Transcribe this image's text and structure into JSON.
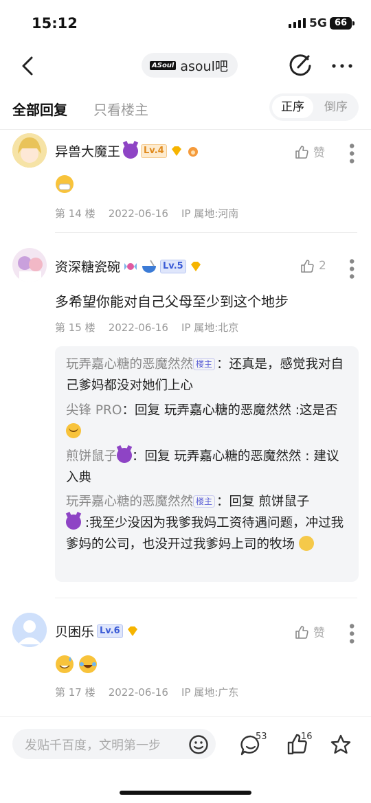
{
  "status_bar": {
    "time": "15:12",
    "network": "5G",
    "battery": "66"
  },
  "nav": {
    "forum_logo": "ASoul",
    "forum_name": "asoul吧"
  },
  "tabs": {
    "all": "全部回复",
    "owner_only": "只看楼主",
    "asc": "正序",
    "desc": "倒序"
  },
  "posts": [
    {
      "username": "异兽大魔王",
      "level": "Lv.4",
      "like_label": "赞",
      "floor": "第 14 楼",
      "date": "2022-06-16",
      "ip": "IP 属地:河南",
      "level_color": "#e08a1e",
      "level_bg": "#fdebcf"
    },
    {
      "username": "资深糖瓷碗",
      "level": "Lv.5",
      "like_label": "2",
      "floor": "第 15 楼",
      "date": "2022-06-16",
      "ip": "IP 属地:北京",
      "text": "多希望你能对自己父母至少到这个地步",
      "level_color": "#3b5bd6",
      "level_bg": "#dfe6fb"
    },
    {
      "username": "贝困乐",
      "level": "Lv.6",
      "like_label": "赞",
      "floor": "第 17 楼",
      "date": "2022-06-16",
      "ip": "IP 属地:广东",
      "level_color": "#3b5bd6",
      "level_bg": "#dfe6fb"
    }
  ],
  "replies": [
    {
      "name": "玩弄嘉心糖的恶魔然然",
      "owner_tag": "楼主",
      "sep": "：",
      "text": "还真是，感觉我对自己爹妈都没对她们上心"
    },
    {
      "name": "尖锋 PRO",
      "sep": "：",
      "text": "回复 玩弄嘉心糖的恶魔然然 :这是否"
    },
    {
      "name": "煎饼鼠子",
      "sep": "：",
      "text": "回复 玩弄嘉心糖的恶魔然然 : 建议入典"
    },
    {
      "name": "玩弄嘉心糖的恶魔然然",
      "owner_tag": "楼主",
      "sep": "：",
      "text_a": "回复 煎饼鼠子",
      "text_b": " :我至少没因为我爹我妈工资待遇问题，冲过我爹妈的公司，也没开过我爹妈上司的牧场"
    }
  ],
  "bottom_bar": {
    "placeholder": "发贴千百度，文明第一步",
    "comment_count": "53",
    "like_count": "16"
  },
  "icons": [
    "back-icon",
    "edit-icon",
    "more-icon",
    "like-icon",
    "more-dots-icon",
    "smile-icon",
    "comment-icon",
    "thumb-icon",
    "star-icon",
    "gem-icon",
    "devil-emoji-icon"
  ],
  "colors": {
    "accent": "#5b5fd6",
    "gem": "#f6b400"
  }
}
